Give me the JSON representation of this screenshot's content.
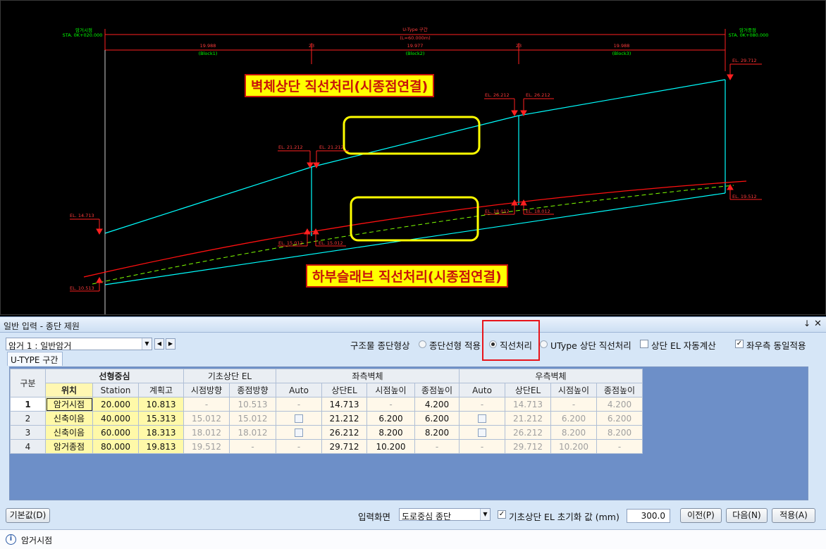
{
  "drawing": {
    "start_label": "암거시점",
    "start_sta": "STA. 0K+020.000",
    "end_label": "암거종점",
    "end_sta": "STA. 0K+080.000",
    "total_label": "U-Type 구간",
    "total_length": "(L=60.000m)",
    "blocks": [
      {
        "length": "19.988",
        "name": "(Block1)"
      },
      {
        "length": "19.977",
        "name": "(Block2)"
      },
      {
        "length": "19.988",
        "name": "(Block3)"
      }
    ],
    "joints": [
      "23",
      "23"
    ],
    "elevations": {
      "wall_start": "EL. 14.713",
      "wall_j1_left": "EL. 21.212",
      "wall_j1_right": "EL. 21.212",
      "wall_j2_left": "EL. 26.212",
      "wall_j2_right": "EL. 26.212",
      "wall_end": "EL. 29.712",
      "base_start": "EL. 10.513",
      "base_j1_left": "EL. 15.012",
      "base_j1_right": "EL. 15.012",
      "base_j2_left": "EL. 18.012",
      "base_j2_right": "EL. 18.012",
      "base_end": "EL. 19.512"
    },
    "callout_top": "벽체상단 직선처리(시종점연결)",
    "callout_bottom": "하부슬래브 직선처리(시종점연결)",
    "colors": {
      "wall_line": "#00ffff",
      "ground_line": "#ff0000",
      "dash_line": "#7fff00",
      "dim_text": "#ff3c3c",
      "label_text": "#00ff00",
      "callout_box": "#ffff00",
      "highlight": "#ffff00"
    }
  },
  "panel": {
    "title": "일반 입력 - 종단 제원",
    "pin_icon": "pin-icon",
    "close_icon": "close-icon",
    "culvert_select": "암거 1 : 일반암거",
    "profile_shape_label": "구조물 종단형상",
    "options": {
      "alignment": "종단선형 적용",
      "straight": "직선처리",
      "utype_straight": "UType 상단 직선처리",
      "auto_el": "상단 EL 자동계산",
      "same_lr": "좌우측 동일적용"
    },
    "option_states": {
      "alignment": false,
      "straight": true,
      "utype_straight": false,
      "auto_el": false,
      "same_lr": true
    },
    "tab": "U-TYPE 구간",
    "grid": {
      "group_headers": {
        "division": "구분",
        "center": "선형중심",
        "base_el": "기초상단 EL",
        "left_wall": "좌측벽체",
        "right_wall": "우측벽체"
      },
      "sub_headers": {
        "position": "위치",
        "station": "Station",
        "plan_height": "계획고",
        "start_dir": "시점방향",
        "end_dir": "종점방향",
        "auto": "Auto",
        "top_el": "상단EL",
        "start_height": "시점높이",
        "end_height": "종점높이"
      },
      "rows": [
        {
          "no": "1",
          "pos": "암거시점",
          "station": "20.000",
          "plan": "10.813",
          "b_start": "-",
          "b_end": "10.513",
          "l_auto": "-",
          "l_top": "14.713",
          "l_sh": "-",
          "l_eh": "4.200",
          "r_auto": "-",
          "r_top": "14.713",
          "r_sh": "-",
          "r_eh": "4.200"
        },
        {
          "no": "2",
          "pos": "신축이음",
          "station": "40.000",
          "plan": "15.313",
          "b_start": "15.012",
          "b_end": "15.012",
          "l_auto": "",
          "l_top": "21.212",
          "l_sh": "6.200",
          "l_eh": "6.200",
          "r_auto": "",
          "r_top": "21.212",
          "r_sh": "6.200",
          "r_eh": "6.200"
        },
        {
          "no": "3",
          "pos": "신축이음",
          "station": "60.000",
          "plan": "18.313",
          "b_start": "18.012",
          "b_end": "18.012",
          "l_auto": "",
          "l_top": "26.212",
          "l_sh": "8.200",
          "l_eh": "8.200",
          "r_auto": "",
          "r_top": "26.212",
          "r_sh": "8.200",
          "r_eh": "8.200"
        },
        {
          "no": "4",
          "pos": "암거종점",
          "station": "80.000",
          "plan": "19.813",
          "b_start": "19.512",
          "b_end": "-",
          "l_auto": "-",
          "l_top": "29.712",
          "l_sh": "10.200",
          "l_eh": "-",
          "r_auto": "-",
          "r_top": "29.712",
          "r_sh": "10.200",
          "r_eh": "-"
        }
      ]
    },
    "default_button": "기본값(D)",
    "input_screen_label": "입력화면",
    "input_screen_value": "도로중심 종단",
    "init_label": "기초상단 EL 초기화 값 (mm)",
    "init_checked": true,
    "init_value": "300.0",
    "prev_button": "이전(P)",
    "next_button": "다음(N)",
    "apply_button": "적용(A)",
    "status_text": "암거시점"
  }
}
